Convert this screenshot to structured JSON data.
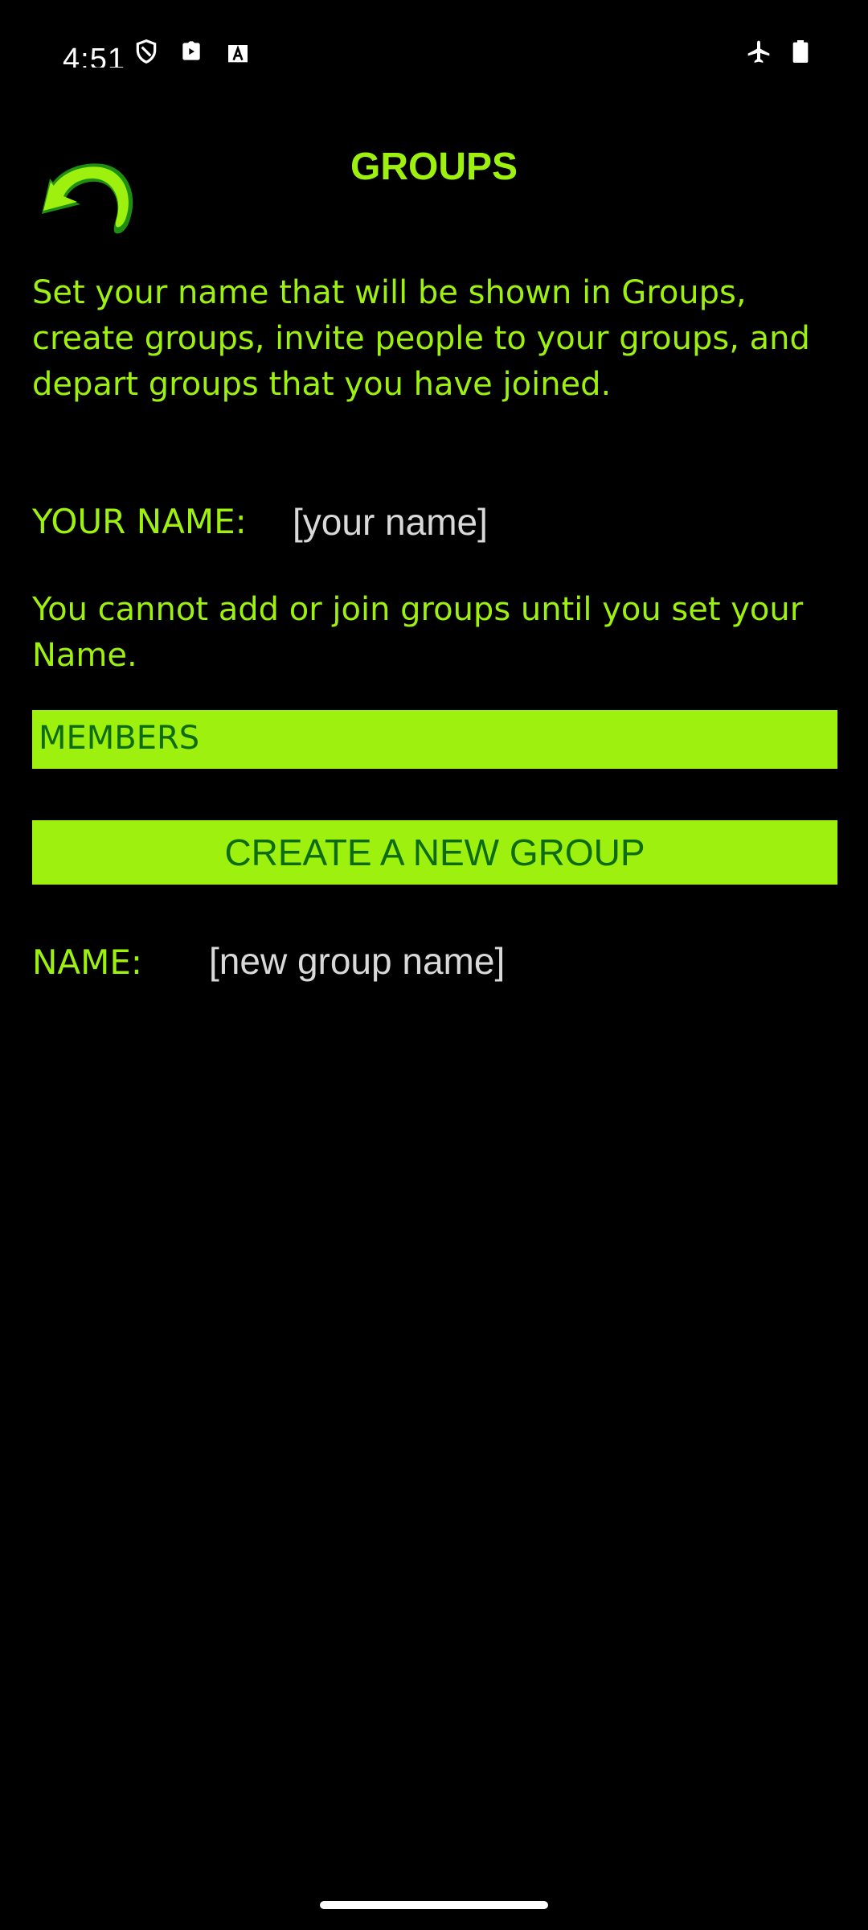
{
  "status_bar": {
    "time": "4:51",
    "icons": [
      "shield-icon",
      "play-store-icon",
      "font-a-icon",
      "airplane-icon",
      "battery-icon"
    ]
  },
  "header": {
    "title": "GROUPS",
    "back_icon": "back-arrow-icon"
  },
  "intro": {
    "text": "Set your name that will be shown in Groups, create groups, invite people to your groups, and depart groups that you have joined."
  },
  "your_name": {
    "label": "YOUR NAME:",
    "placeholder": "[your name]",
    "value": ""
  },
  "warning": {
    "text": "You cannot add or join groups until you set your Name."
  },
  "members": {
    "label": "MEMBERS"
  },
  "create_group": {
    "button_label": "CREATE A NEW GROUP"
  },
  "new_group": {
    "label": "NAME:",
    "placeholder": "[new group name]",
    "value": ""
  },
  "colors": {
    "background": "#000000",
    "accent": "#9ef00f",
    "accent_text": "#0d6b10",
    "placeholder": "#d9d9d9"
  }
}
